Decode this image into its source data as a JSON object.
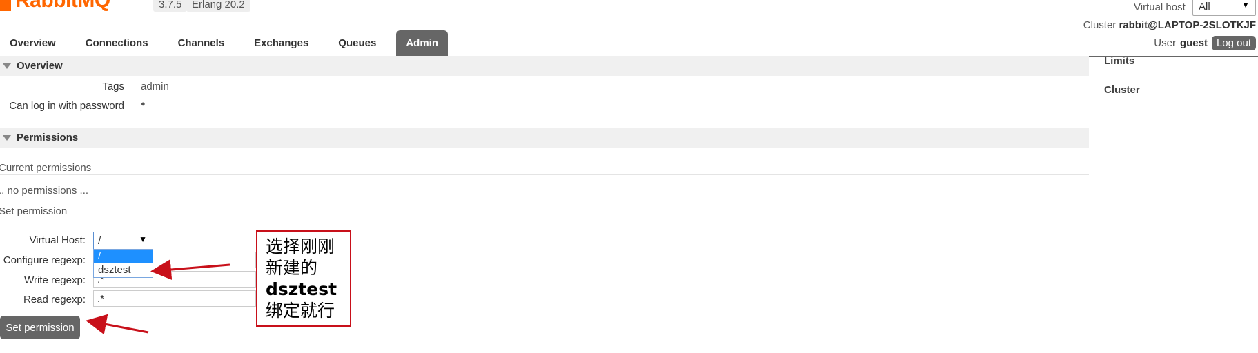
{
  "header": {
    "logo_text": "RabbitMQ",
    "version": "3.7.5",
    "erlang": "Erlang 20.2",
    "virtual_host_label": "Virtual host",
    "virtual_host_value": "All",
    "cluster_label": "Cluster",
    "cluster_name": "rabbit@LAPTOP-2SLOTKJF",
    "user_label": "User",
    "user_name": "guest",
    "logout_label": "Log out"
  },
  "tabs": [
    {
      "label": "Overview",
      "active": false
    },
    {
      "label": "Connections",
      "active": false
    },
    {
      "label": "Channels",
      "active": false
    },
    {
      "label": "Exchanges",
      "active": false
    },
    {
      "label": "Queues",
      "active": false
    },
    {
      "label": "Admin",
      "active": true
    }
  ],
  "overview": {
    "title": "Overview",
    "tags_label": "Tags",
    "tags_value": "admin",
    "password_label": "Can log in with password",
    "password_value": "●"
  },
  "permissions": {
    "title": "Permissions",
    "current_title": "Current permissions",
    "no_permissions": ".. no permissions ...",
    "set_title": "Set permission",
    "virtual_host_label": "Virtual Host:",
    "virtual_host_selected": "/",
    "virtual_host_options": [
      "/",
      "dsztest"
    ],
    "configure_label": "Configure regexp:",
    "configure_value": ".*",
    "write_label": "Write regexp:",
    "write_value": ".*",
    "read_label": "Read regexp:",
    "read_value": ".*",
    "submit_label": "Set permission"
  },
  "sidebar": {
    "limits": "Limits",
    "cluster": "Cluster"
  },
  "annotation": {
    "line1": "选择刚刚",
    "line2": "新建的",
    "line3": "dsztest",
    "line4": "绑定就行",
    "color": "#c8101a"
  },
  "colors": {
    "accent": "#ff6600",
    "tab_active": "#666666",
    "button": "#666666"
  }
}
